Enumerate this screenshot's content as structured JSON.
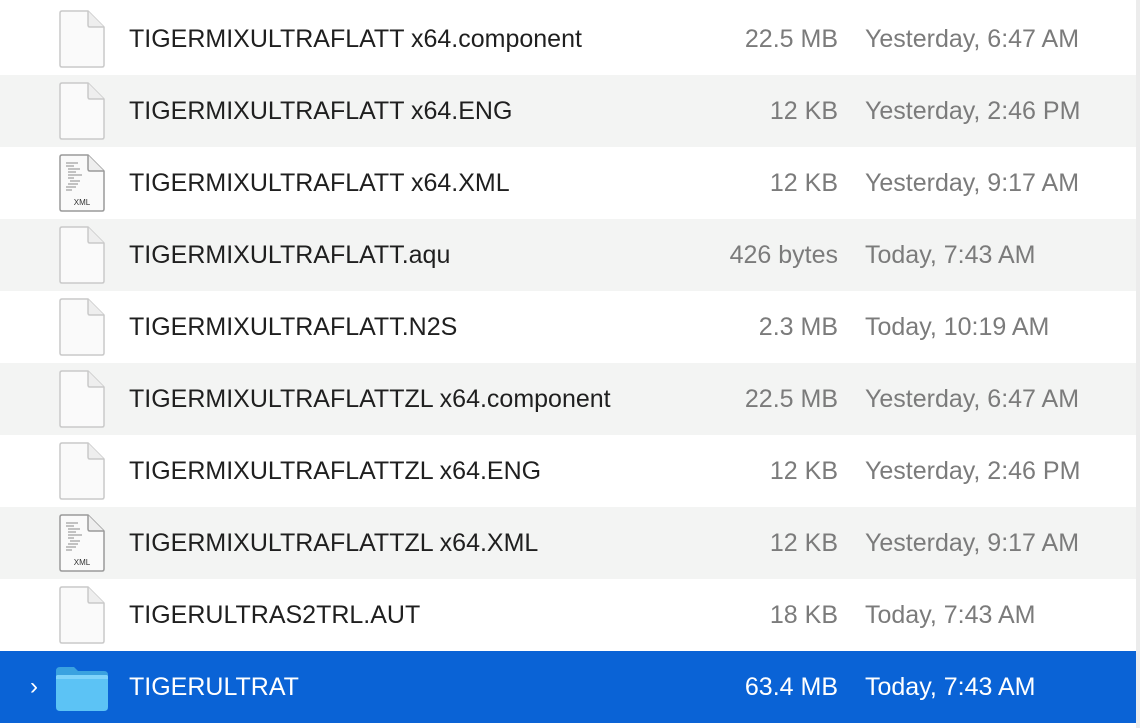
{
  "files": [
    {
      "name": "TIGERMIXULTRAFLATT x64.component",
      "size": "22.5 MB",
      "date": "Yesterday, 6:47 AM",
      "icon": "document-icon"
    },
    {
      "name": "TIGERMIXULTRAFLATT x64.ENG",
      "size": "12 KB",
      "date": "Yesterday, 2:46 PM",
      "icon": "document-icon"
    },
    {
      "name": "TIGERMIXULTRAFLATT x64.XML",
      "size": "12 KB",
      "date": "Yesterday, 9:17 AM",
      "icon": "xml-file-icon",
      "icon_label": "XML"
    },
    {
      "name": "TIGERMIXULTRAFLATT.aqu",
      "size": "426 bytes",
      "date": "Today, 7:43 AM",
      "icon": "document-icon"
    },
    {
      "name": "TIGERMIXULTRAFLATT.N2S",
      "size": "2.3 MB",
      "date": "Today, 10:19 AM",
      "icon": "document-icon"
    },
    {
      "name": "TIGERMIXULTRAFLATTZL x64.component",
      "size": "22.5 MB",
      "date": "Yesterday, 6:47 AM",
      "icon": "document-icon"
    },
    {
      "name": "TIGERMIXULTRAFLATTZL x64.ENG",
      "size": "12 KB",
      "date": "Yesterday, 2:46 PM",
      "icon": "document-icon"
    },
    {
      "name": "TIGERMIXULTRAFLATTZL x64.XML",
      "size": "12 KB",
      "date": "Yesterday, 9:17 AM",
      "icon": "xml-file-icon",
      "icon_label": "XML"
    },
    {
      "name": "TIGERULTRAS2TRL.AUT",
      "size": "18 KB",
      "date": "Today, 7:43 AM",
      "icon": "document-icon"
    },
    {
      "name": "TIGERULTRAT",
      "size": "63.4 MB",
      "date": "Today, 7:43 AM",
      "icon": "folder-icon",
      "disclosure": "›"
    }
  ],
  "colors": {
    "selection": "#0a63d6",
    "alt_row": "#f3f4f3",
    "secondary_text": "#7b7b7b",
    "folder": "#48b6f0"
  }
}
